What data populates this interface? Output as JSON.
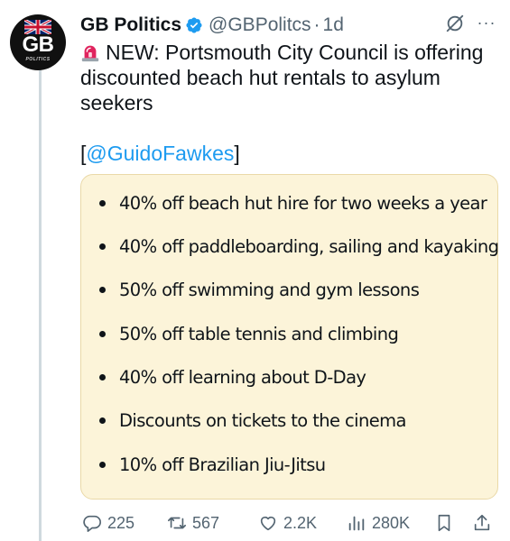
{
  "author": {
    "name": "GB Politics",
    "handle": "@GBPolitcs",
    "separator": "·",
    "time": "1d",
    "avatar_text": "GB",
    "avatar_subtext": "POLITICS",
    "verified_color": "#1d9bf0"
  },
  "tweet": {
    "emoji": "siren-emoji",
    "line1": "NEW: Portsmouth City Council is offering",
    "line2": "discounted beach hut rentals to asylum",
    "line3": "seekers",
    "mention_open": "[",
    "mention": "@GuidoFawkes",
    "mention_close": "]"
  },
  "card": {
    "background": "#fcf4d9",
    "items": [
      "40% off beach hut hire for two weeks a year",
      "40% off paddleboarding, sailing and kayaking",
      "50% off swimming and gym lessons",
      "50% off table tennis and climbing",
      "40% off learning about D-Day",
      "Discounts on tickets to the cinema",
      "10% off Brazilian Jiu-Jitsu"
    ]
  },
  "actions": {
    "replies": "225",
    "reposts": "567",
    "likes": "2.2K",
    "views": "280K"
  },
  "colors": {
    "accent": "#1d9bf0",
    "muted": "#536471",
    "text": "#0f1419"
  }
}
